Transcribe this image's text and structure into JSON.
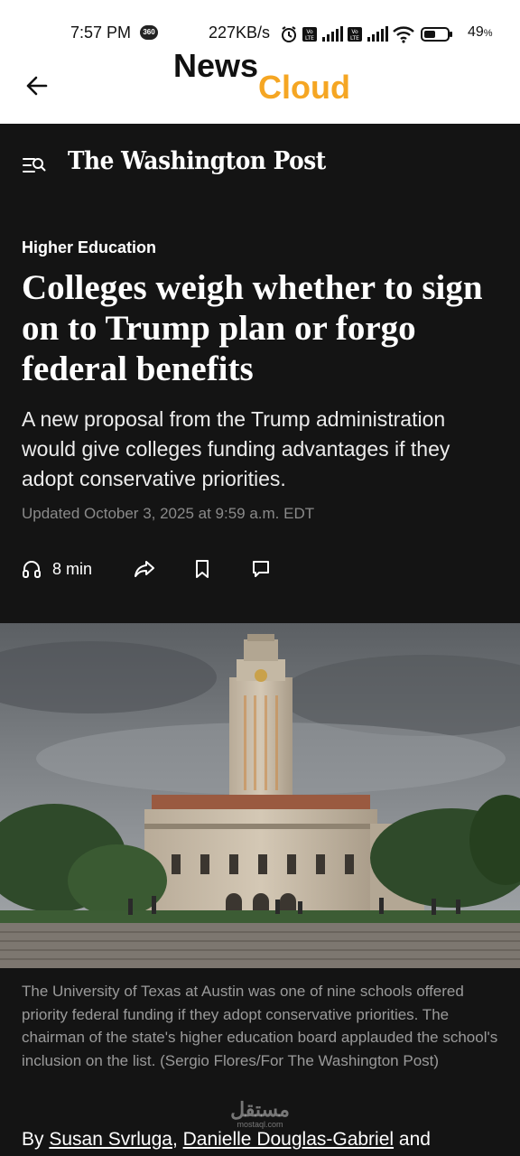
{
  "status_bar": {
    "time": "7:57 PM",
    "badge": "360",
    "speed": "227KB/s",
    "battery": "49",
    "battery_unit": "%",
    "icons": [
      "alarm-icon",
      "volte-icon",
      "signal-icon",
      "volte-icon",
      "signal-icon",
      "wifi-icon",
      "battery-icon"
    ]
  },
  "app_header": {
    "back_icon": "back-arrow-icon",
    "logo_part1": "News",
    "logo_part2": "Cloud",
    "logo_accent_color": "#f5a623"
  },
  "publication": {
    "menu_icon": "menu-search-icon",
    "name": "The Washington Post"
  },
  "article": {
    "section": "Higher Education",
    "headline": "Colleges weigh whether to sign on to Trump plan or forgo federal benefits",
    "dek": "A new proposal from the Trump administration would give colleges funding advantages if they adopt conservative priorities.",
    "updated": "Updated October 3, 2025 at 9:59 a.m. EDT",
    "actions": {
      "listen_label": "8 min",
      "listen_icon": "headphones-icon",
      "share_icon": "share-icon",
      "bookmark_icon": "bookmark-icon",
      "comment_icon": "comment-icon"
    },
    "photo_caption": "The University of Texas at Austin was one of nine schools offered priority federal funding if they adopt conservative priorities. The chairman of the state's higher education board applauded the school's inclusion on the list. (Sergio Flores/For The Washington Post)",
    "byline_prefix": "By ",
    "authors": [
      "Susan Svrluga",
      "Danielle Douglas-Gabriel"
    ],
    "byline_sep": ", ",
    "byline_suffix": " and"
  },
  "watermark": {
    "main": "مستقل",
    "sub": "mostaql.com"
  }
}
